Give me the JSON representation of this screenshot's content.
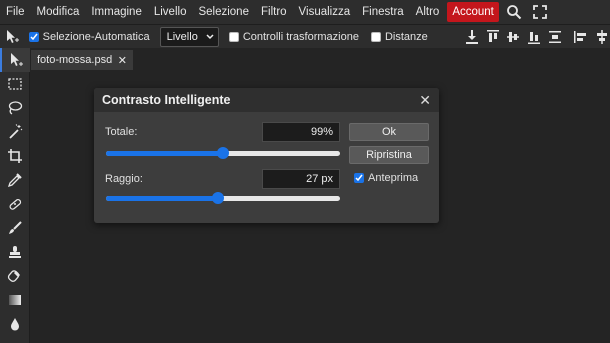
{
  "menubar": {
    "items": [
      "File",
      "Modifica",
      "Immagine",
      "Livello",
      "Selezione",
      "Filtro",
      "Visualizza",
      "Finestra",
      "Altro"
    ],
    "account": "Account",
    "icons": [
      "search-icon",
      "fullscreen-icon"
    ],
    "account_color": "#c4161c"
  },
  "options": {
    "auto_select_label": "Selezione-Automatica",
    "auto_select_checked": true,
    "layer_select_value": "Livello",
    "transform_controls_label": "Controlli trasformazione",
    "transform_controls_checked": false,
    "distances_label": "Distanze",
    "distances_checked": false
  },
  "document": {
    "tab_name": "foto-mossa.psd",
    "close_symbol": "✕"
  },
  "dialog": {
    "title": "Contrasto Intelligente",
    "close_symbol": "✕",
    "amount_label": "Totale:",
    "amount_value": "99%",
    "amount_fraction": 0.5,
    "radius_label": "Raggio:",
    "radius_value": "27 px",
    "radius_fraction": 0.48,
    "ok_label": "Ok",
    "reset_label": "Ripristina",
    "preview_label": "Anteprima",
    "preview_checked": true
  },
  "colors": {
    "accent": "#1a73e8",
    "background": "#242424",
    "panel": "#2d2d2d"
  }
}
